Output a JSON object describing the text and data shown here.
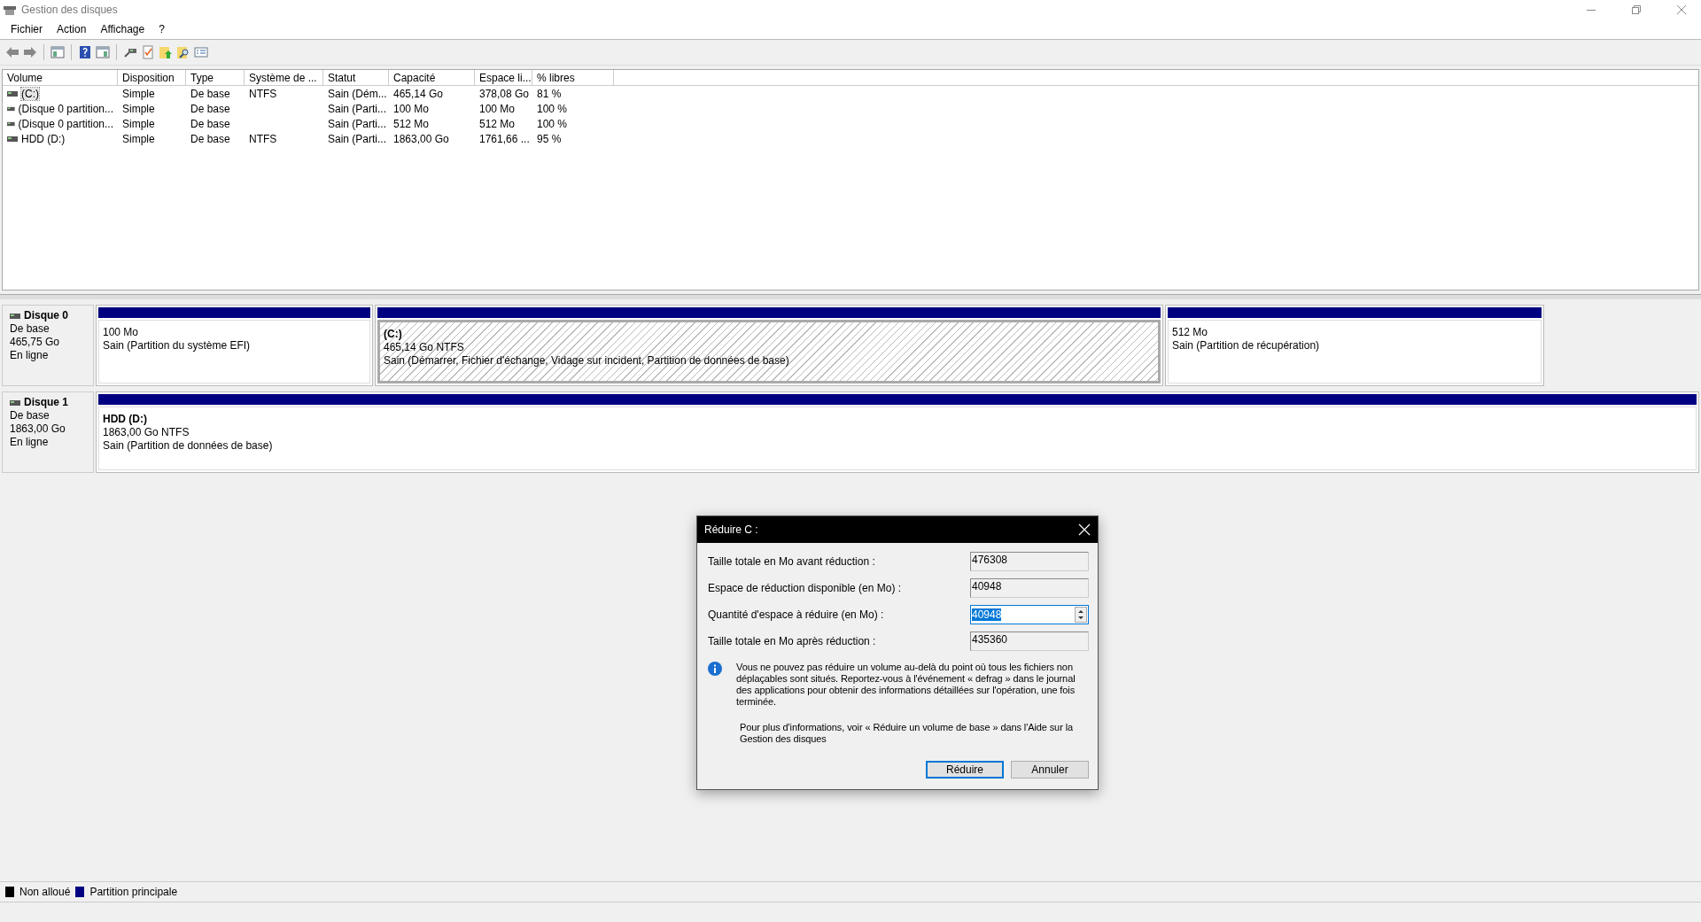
{
  "window": {
    "title": "Gestion des disques"
  },
  "menu": [
    {
      "label": "Fichier"
    },
    {
      "label": "Action"
    },
    {
      "label": "Affichage"
    },
    {
      "label": "?"
    }
  ],
  "table": {
    "columns": [
      "Volume",
      "Disposition",
      "Type",
      "Système de ...",
      "Statut",
      "Capacité",
      "Espace li...",
      "% libres"
    ],
    "rows": [
      {
        "selected": true,
        "volume": "(C:)",
        "disposition": "Simple",
        "type": "De base",
        "file_system": "NTFS",
        "status": "Sain (Dém...",
        "capacity": "465,14 Go",
        "free_space": "378,08 Go",
        "percent_free": "81 %"
      },
      {
        "selected": false,
        "volume": "(Disque 0 partition...",
        "disposition": "Simple",
        "type": "De base",
        "status": "Sain (Parti...",
        "capacity": "100 Mo",
        "free_space": "100 Mo",
        "percent_free": "100 %"
      },
      {
        "selected": false,
        "volume": "(Disque 0 partition...",
        "disposition": "Simple",
        "type": "De base",
        "status": "Sain (Parti...",
        "capacity": "512 Mo",
        "free_space": "512 Mo",
        "percent_free": "100 %"
      },
      {
        "selected": false,
        "volume": "HDD (D:)",
        "disposition": "Simple",
        "type": "De base",
        "file_system": "NTFS",
        "status": "Sain (Parti...",
        "capacity": "1863,00 Go",
        "free_space": "1761,66 ...",
        "percent_free": "95 %"
      }
    ]
  },
  "disks": [
    {
      "name": "Disque 0",
      "type": "De base",
      "size": "465,75 Go",
      "state": "En ligne",
      "partitions": [
        {
          "selected": false,
          "size": "100 Mo",
          "status": "Sain (Partition du système EFI)"
        },
        {
          "selected": true,
          "title": "(C:)",
          "size": "465,14 Go NTFS",
          "status": "Sain (Démarrer, Fichier d'échange, Vidage sur incident, Partition de données de base)"
        },
        {
          "selected": false,
          "size": "512 Mo",
          "status": "Sain (Partition de récupération)"
        }
      ]
    },
    {
      "name": "Disque 1",
      "type": "De base",
      "size": "1863,00 Go",
      "state": "En ligne",
      "partitions": [
        {
          "selected": false,
          "title": "HDD  (D:)",
          "size": "1863,00 Go NTFS",
          "status": "Sain (Partition de données de base)"
        }
      ]
    }
  ],
  "legend": [
    {
      "label": "Non alloué",
      "color": "#000000"
    },
    {
      "label": "Partition principale",
      "color": "#000080"
    }
  ],
  "dialog": {
    "title": "Réduire C :",
    "fields": [
      {
        "kind": "readonly",
        "label": "Taille totale en Mo avant réduction :",
        "value": "476308",
        "selected": false
      },
      {
        "kind": "readonly",
        "label": "Espace de réduction disponible (en Mo) :",
        "value": "40948",
        "selected": false
      },
      {
        "kind": "spinner",
        "label": "Quantité d'espace à réduire (en Mo) :",
        "value": "40948",
        "selected": true
      },
      {
        "kind": "readonly",
        "label": "Taille totale en Mo après réduction :",
        "value": "435360",
        "selected": false
      }
    ],
    "info": "Vous ne pouvez pas réduire un volume au-delà du point où tous les fichiers non déplaçables sont situés. Reportez-vous à l'événement « defrag » dans le journal des applications pour obtenir des informations détaillées sur l'opération, une fois terminée.",
    "more_info": "Pour plus d'informations, voir « Réduire un volume de base » dans l'Aide sur la Gestion des disques",
    "buttons": [
      {
        "label": "Réduire",
        "default": true
      },
      {
        "label": "Annuler",
        "default": false
      }
    ]
  }
}
